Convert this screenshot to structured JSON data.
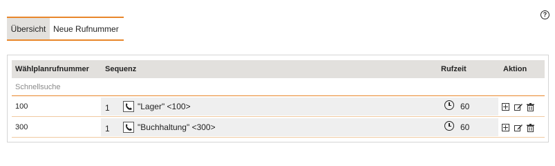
{
  "help": {
    "glyph": "?"
  },
  "tabs": [
    {
      "label": "Übersicht",
      "active": true
    },
    {
      "label": "Neue Rufnummer",
      "active": false
    }
  ],
  "table": {
    "headers": {
      "number": "Wählplanrufnummer",
      "sequence": "Sequenz",
      "ring_time": "Rufzeit",
      "action": "Aktion"
    },
    "search_placeholder": "Schnellsuche",
    "rows": [
      {
        "number": "100",
        "seq_index": "1",
        "target": "\"Lager\" <100>",
        "ring_time": "60"
      },
      {
        "number": "300",
        "seq_index": "1",
        "target": "\"Buchhaltung\" <300>",
        "ring_time": "60"
      }
    ]
  },
  "colors": {
    "accent": "#e8862a",
    "header_bg": "#e2e0dd",
    "cell_bg": "#efefef"
  }
}
